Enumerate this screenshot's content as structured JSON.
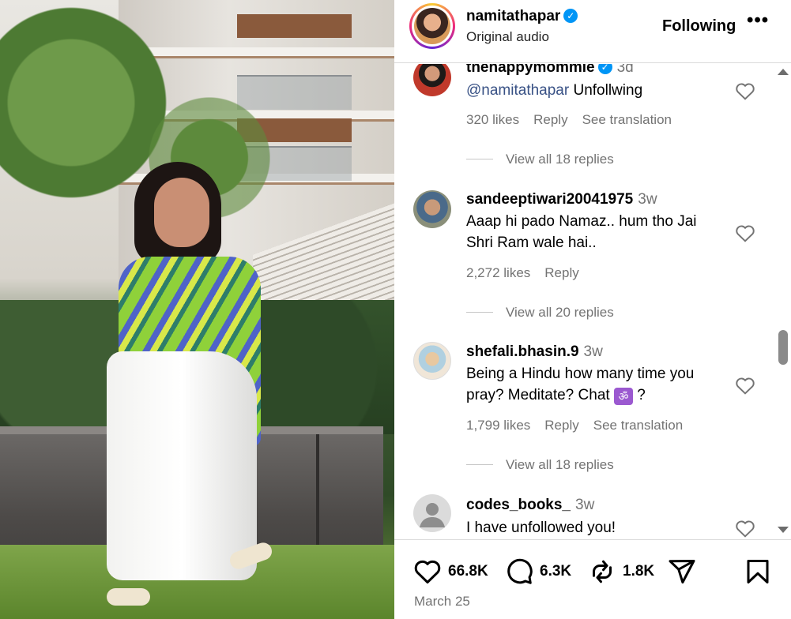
{
  "header": {
    "username": "namitathapar",
    "subtitle": "Original audio",
    "follow_label": "Following",
    "more_label": "•••"
  },
  "comments": [
    {
      "user": "thehappymommie",
      "verified": true,
      "time": "3d",
      "mention": "@namitathapar",
      "text": " Unfollwing",
      "likes": "320 likes",
      "reply": "Reply",
      "translate": "See translation",
      "view_replies": "View all 18 replies"
    },
    {
      "user": "sandeeptiwari20041975",
      "time": "3w",
      "text": "Aaap hi pado Namaz.. hum tho Jai Shri Ram wale hai..",
      "likes": "2,272 likes",
      "reply": "Reply",
      "view_replies": "View all 20 replies"
    },
    {
      "user": "shefali.bhasin.9",
      "time": "3w",
      "text_before": "Being a Hindu how many time you pray? Meditate? Chat ",
      "emoji": "ॐ",
      "text_after": " ?",
      "likes": "1,799 likes",
      "reply": "Reply",
      "translate": "See translation",
      "view_replies": "View all 18 replies"
    },
    {
      "user": "codes_books_",
      "time": "3w",
      "text": "I have unfollowed you!"
    }
  ],
  "actions": {
    "likes_count": "66.8K",
    "comments_count": "6.3K",
    "reposts_count": "1.8K",
    "date": "March 25"
  },
  "icons": [
    "verified-badge-icon",
    "heart-icon",
    "comment-icon",
    "repost-icon",
    "share-icon",
    "bookmark-icon",
    "more-icon"
  ],
  "colors": {
    "link": "#385185",
    "muted": "#737373",
    "verified": "#0095f6",
    "divider": "#dbdbdb"
  }
}
